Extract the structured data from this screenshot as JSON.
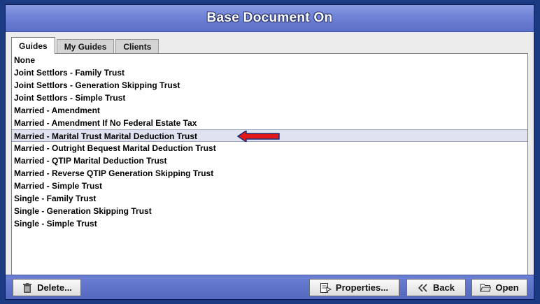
{
  "window": {
    "title": "Base Document On"
  },
  "tabs": [
    {
      "label": "Guides",
      "active": true
    },
    {
      "label": "My Guides",
      "active": false
    },
    {
      "label": "Clients",
      "active": false
    }
  ],
  "list": {
    "items": [
      "None",
      "Joint Settlors - Family Trust",
      "Joint Settlors - Generation Skipping Trust",
      "Joint Settlors - Simple Trust",
      "Married - Amendment",
      "Married - Amendment If No Federal Estate Tax",
      "Married - Marital Trust Marital Deduction Trust",
      "Married - Outright Bequest Marital Deduction Trust",
      "Married - QTIP Marital Deduction Trust",
      "Married - Reverse QTIP Generation Skipping Trust",
      "Married - Simple Trust",
      "Single - Family Trust",
      "Single - Generation Skipping Trust",
      "Single - Simple Trust"
    ],
    "selected_index": 6
  },
  "buttons": {
    "delete": "Delete...",
    "properties": "Properties...",
    "back": "Back",
    "open": "Open"
  },
  "colors": {
    "accent": "#6f82d6",
    "background": "#1c3a82",
    "arrow": "#e01818"
  },
  "icons": {
    "delete": "trash-icon",
    "properties": "properties-icon",
    "back": "back-chevron-icon",
    "open": "open-folder-icon",
    "annotation": "red-arrow-icon"
  }
}
